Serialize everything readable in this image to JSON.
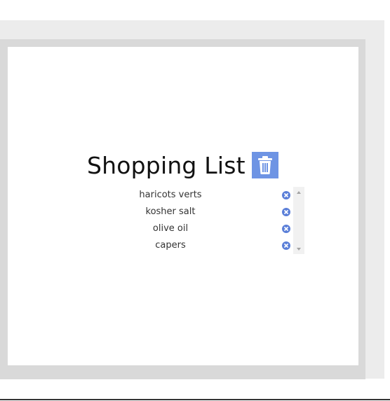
{
  "app": {
    "title": "Shopping List",
    "clear_icon": "trash-icon",
    "accent_color": "#6e94e4",
    "remove_icon_color": "#5b7fd8"
  },
  "list": {
    "items": [
      {
        "label": "haricots verts",
        "remove_icon": "close-circle-icon"
      },
      {
        "label": "kosher salt",
        "remove_icon": "close-circle-icon"
      },
      {
        "label": "olive oil",
        "remove_icon": "close-circle-icon"
      },
      {
        "label": "capers",
        "remove_icon": "close-circle-icon"
      }
    ]
  }
}
